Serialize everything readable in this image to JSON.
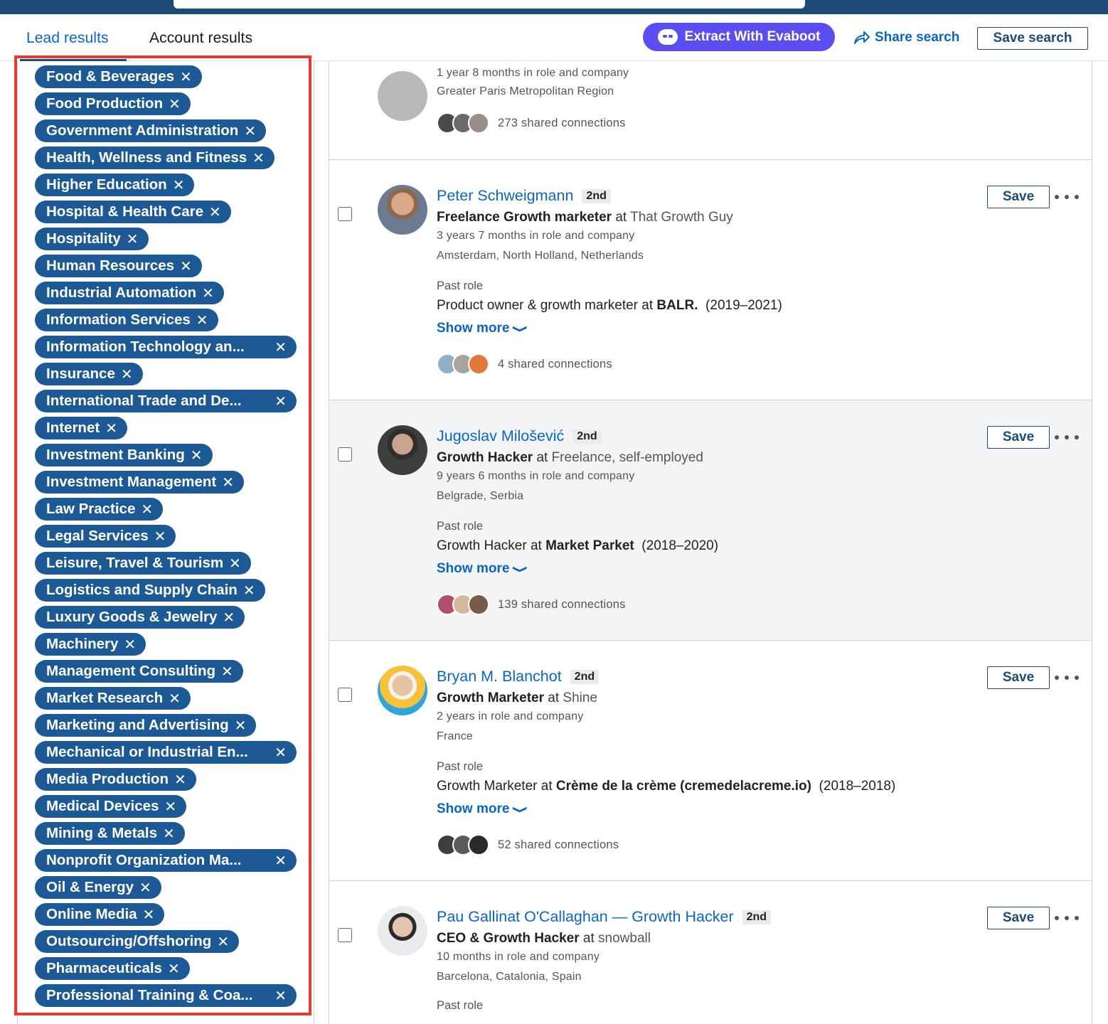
{
  "tabs": {
    "lead": "Lead results",
    "account": "Account results"
  },
  "toolbar": {
    "evaboot": "Extract With Evaboot",
    "share": "Share search",
    "save_search": "Save search"
  },
  "filters": [
    {
      "label": "Food & Beverages",
      "truncated": false
    },
    {
      "label": "Food Production",
      "truncated": false
    },
    {
      "label": "Government Administration",
      "truncated": false
    },
    {
      "label": "Health, Wellness and Fitness",
      "truncated": false
    },
    {
      "label": "Higher Education",
      "truncated": false
    },
    {
      "label": "Hospital & Health Care",
      "truncated": false
    },
    {
      "label": "Hospitality",
      "truncated": false
    },
    {
      "label": "Human Resources",
      "truncated": false
    },
    {
      "label": "Industrial Automation",
      "truncated": false
    },
    {
      "label": "Information Services",
      "truncated": false
    },
    {
      "label": "Information Technology an...",
      "truncated": true
    },
    {
      "label": "Insurance",
      "truncated": false
    },
    {
      "label": "International Trade and De...",
      "truncated": true
    },
    {
      "label": "Internet",
      "truncated": false
    },
    {
      "label": "Investment Banking",
      "truncated": false
    },
    {
      "label": "Investment Management",
      "truncated": false
    },
    {
      "label": "Law Practice",
      "truncated": false
    },
    {
      "label": "Legal Services",
      "truncated": false
    },
    {
      "label": "Leisure, Travel & Tourism",
      "truncated": false
    },
    {
      "label": "Logistics and Supply Chain",
      "truncated": false
    },
    {
      "label": "Luxury Goods & Jewelry",
      "truncated": false
    },
    {
      "label": "Machinery",
      "truncated": false
    },
    {
      "label": "Management Consulting",
      "truncated": false
    },
    {
      "label": "Market Research",
      "truncated": false
    },
    {
      "label": "Marketing and Advertising",
      "truncated": false
    },
    {
      "label": "Mechanical or Industrial En...",
      "truncated": true
    },
    {
      "label": "Media Production",
      "truncated": false
    },
    {
      "label": "Medical Devices",
      "truncated": false
    },
    {
      "label": "Mining & Metals",
      "truncated": false
    },
    {
      "label": "Nonprofit Organization Ma...",
      "truncated": true
    },
    {
      "label": "Oil & Energy",
      "truncated": false
    },
    {
      "label": "Online Media",
      "truncated": false
    },
    {
      "label": "Outsourcing/Offshoring",
      "truncated": false
    },
    {
      "label": "Pharmaceuticals",
      "truncated": false
    },
    {
      "label": "Professional Training & Coa...",
      "truncated": true
    }
  ],
  "remove_glyph": "✕",
  "first_card": {
    "tenure": "1 year 8 months in role and company",
    "location": "Greater Paris Metropolitan Region",
    "connections": "273 shared connections"
  },
  "leads": [
    {
      "name": "Peter Schweigmann",
      "degree": "2nd",
      "role": "Freelance Growth marketer",
      "at": "at",
      "company": "That Growth Guy",
      "tenure": "3 years 7 months in role and company",
      "location": "Amsterdam, North Holland, Netherlands",
      "past_label": "Past role",
      "past_prefix": "Product owner & growth marketer at ",
      "past_company": "BALR.",
      "past_years": "(2019–2021)",
      "show_more": "Show more",
      "connections": "4 shared connections",
      "save": "Save",
      "highlighted": false
    },
    {
      "name": "Jugoslav Milošević",
      "degree": "2nd",
      "role": "Growth Hacker",
      "at": "at",
      "company": "Freelance, self-employed",
      "tenure": "9 years 6 months in role and company",
      "location": "Belgrade, Serbia",
      "past_label": "Past role",
      "past_prefix": "Growth Hacker at ",
      "past_company": "Market Parket",
      "past_years": "(2018–2020)",
      "show_more": "Show more",
      "connections": "139 shared connections",
      "save": "Save",
      "highlighted": true
    },
    {
      "name": "Bryan M. Blanchot",
      "degree": "2nd",
      "role": "Growth Marketer",
      "at": "at",
      "company": "Shine",
      "tenure": "2 years in role and company",
      "location": "France",
      "past_label": "Past role",
      "past_prefix": "Growth Marketer at ",
      "past_company": "Crème de la crème (cremedelacreme.io)",
      "past_years": "(2018–2018)",
      "show_more": "Show more",
      "connections": "52 shared connections",
      "save": "Save",
      "highlighted": false
    },
    {
      "name": "Pau Gallinat O'Callaghan — Growth Hacker",
      "degree": "2nd",
      "role": "CEO & Growth Hacker",
      "at": "at",
      "company": "snowball",
      "tenure": "10 months in role and company",
      "location": "Barcelona, Catalonia, Spain",
      "past_label": "Past role",
      "save": "Save",
      "highlighted": false
    }
  ],
  "colors": {
    "accent": "#0a66c2",
    "pill": "#1d5a95",
    "evaboot": "#5b4ef0",
    "highlight_box": "#e03d2f",
    "topbar": "#1d4b75"
  }
}
